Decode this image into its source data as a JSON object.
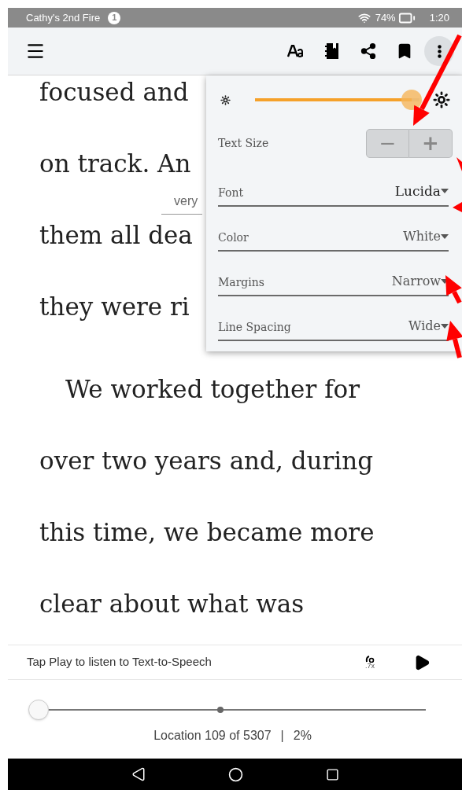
{
  "status_bar": {
    "device_name": "Cathy's 2nd Fire",
    "notification_count": "1",
    "battery": "74%",
    "time": "1:20"
  },
  "book": {
    "paragraphs": [
      {
        "indented": false,
        "lines": [
          "focused and",
          "on track. An",
          "them all dea",
          "they were ri"
        ]
      },
      {
        "indented": true,
        "lines": [
          "We worked together for",
          "over two years and, during",
          "this time, we became more",
          "clear about what was"
        ]
      }
    ],
    "popup_word": "very"
  },
  "settings_panel": {
    "brightness": {
      "level": 0.95
    },
    "text_size": {
      "label": "Text Size",
      "minus": "−",
      "plus": "+"
    },
    "rows": [
      {
        "kind": "font",
        "label": "Font",
        "value": "Lucida"
      },
      {
        "kind": "plain",
        "label": "Color",
        "value": "White"
      },
      {
        "kind": "plain",
        "label": "Margins",
        "value": "Narrow"
      },
      {
        "kind": "plain",
        "label": "Line Spacing",
        "value": "Wide"
      }
    ]
  },
  "tts": {
    "prompt": "Tap Play to listen to Text-to-Speech",
    "speed": ".7x"
  },
  "progress": {
    "level": 0,
    "location": "Location 109 of 5307",
    "separator": "|",
    "percent": "2%"
  }
}
